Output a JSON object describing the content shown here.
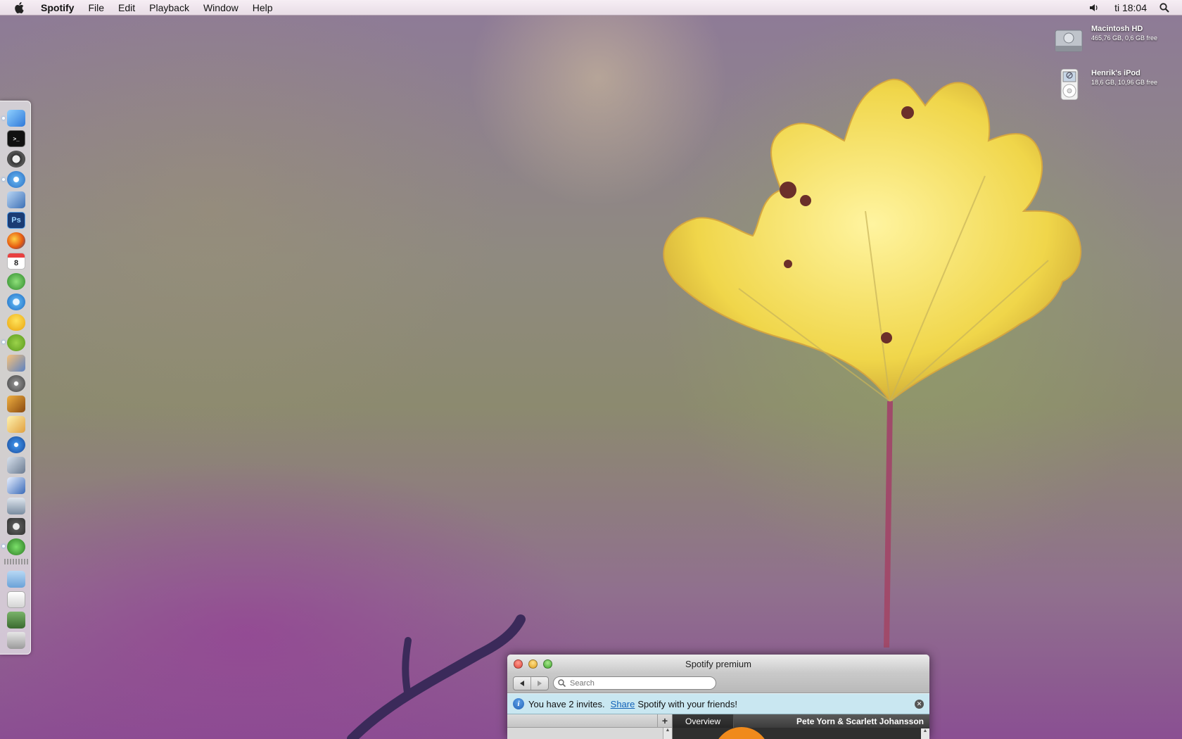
{
  "menubar": {
    "app_name": "Spotify",
    "items": [
      "File",
      "Edit",
      "Playback",
      "Window",
      "Help"
    ],
    "clock": "ti 18:04"
  },
  "desktop": {
    "drives": [
      {
        "name": "Macintosh HD",
        "info": "465,76 GB, 0,6 GB free"
      },
      {
        "name": "Henrik's iPod",
        "info": "18,6 GB, 10,96 GB free"
      }
    ]
  },
  "dock": {
    "icons": [
      "finder-icon",
      "terminal-icon",
      "system-preferences-icon",
      "safari-icon",
      "preview-icon",
      "photoshop-icon",
      "firefox-icon",
      "ical-icon",
      "adium-icon",
      "itunes-icon",
      "cyberduck-icon",
      "spotify-icon",
      "iphoto-icon",
      "imovie-icon",
      "garageband-icon",
      "iweb-icon",
      "idvd-icon",
      "utility-icon",
      "activity-monitor-icon",
      "dashboard-icon",
      "compressor-icon",
      "x-app-icon",
      "applications-folder-icon",
      "documents-folder-icon",
      "downloads-folder-icon",
      "trash-icon"
    ],
    "photoshop_label": "Ps",
    "ical_label": "8"
  },
  "window": {
    "title": "Spotify premium",
    "search_placeholder": "Search",
    "banner": {
      "text_before": "You have 2 invites.",
      "link": "Share",
      "text_after": "Spotify with your friends!"
    },
    "tab_overview": "Overview",
    "artist": "Pete Yorn & Scarlett Johansson"
  }
}
